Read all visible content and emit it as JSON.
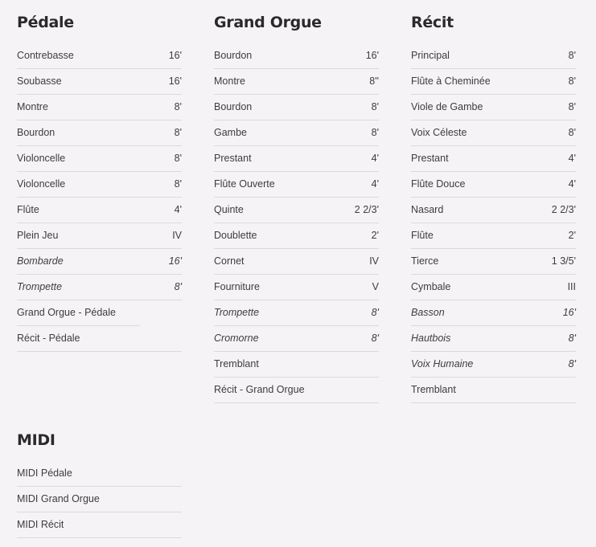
{
  "sections": {
    "pedale": {
      "title": "Pédale",
      "stops": [
        {
          "name": "Contrebasse",
          "size": "16'"
        },
        {
          "name": "Soubasse",
          "size": "16'"
        },
        {
          "name": "Montre",
          "size": "8'"
        },
        {
          "name": "Bourdon",
          "size": "8'"
        },
        {
          "name": "Violoncelle",
          "size": "8'"
        },
        {
          "name": "Violoncelle",
          "size": "8'"
        },
        {
          "name": "Flûte",
          "size": "4'"
        },
        {
          "name": "Plein Jeu",
          "size": "IV"
        },
        {
          "name": "Bombarde",
          "size": "16'"
        },
        {
          "name": "Trompette",
          "size": "8'"
        },
        {
          "name": "Grand Orgue - Pédale",
          "size": ""
        },
        {
          "name": "Récit - Pédale",
          "size": ""
        }
      ]
    },
    "grand_orgue": {
      "title": "Grand Orgue",
      "stops": [
        {
          "name": "Bourdon",
          "size": "16'"
        },
        {
          "name": "Montre",
          "size": "8''"
        },
        {
          "name": "Bourdon",
          "size": "8'"
        },
        {
          "name": "Gambe",
          "size": "8'"
        },
        {
          "name": "Prestant",
          "size": "4'"
        },
        {
          "name": "Flûte Ouverte",
          "size": "4'"
        },
        {
          "name": "Quinte",
          "size": "2 2/3'"
        },
        {
          "name": "Doublette",
          "size": "2'"
        },
        {
          "name": "Cornet",
          "size": "IV"
        },
        {
          "name": "Fourniture",
          "size": "V"
        },
        {
          "name": "Trompette",
          "size": "8'"
        },
        {
          "name": "Cromorne",
          "size": "8'"
        },
        {
          "name": "Tremblant",
          "size": ""
        },
        {
          "name": "Récit - Grand Orgue",
          "size": ""
        }
      ]
    },
    "recit": {
      "title": "Récit",
      "stops": [
        {
          "name": "Principal",
          "size": "8'"
        },
        {
          "name": "Flûte à Cheminée",
          "size": "8'"
        },
        {
          "name": "Viole de Gambe",
          "size": "8'"
        },
        {
          "name": "Voix Céleste",
          "size": "8'"
        },
        {
          "name": "Prestant",
          "size": "4'"
        },
        {
          "name": "Flûte Douce",
          "size": "4'"
        },
        {
          "name": "Nasard",
          "size": "2 2/3'"
        },
        {
          "name": "Flûte",
          "size": "2'"
        },
        {
          "name": "Tierce",
          "size": "1 3/5'"
        },
        {
          "name": "Cymbale",
          "size": "III"
        },
        {
          "name": "Basson",
          "size": "16'"
        },
        {
          "name": "Hautbois",
          "size": "8'"
        },
        {
          "name": "Voix Humaine",
          "size": "8'"
        },
        {
          "name": "Tremblant",
          "size": ""
        }
      ]
    },
    "midi": {
      "title": "MIDI",
      "stops": [
        {
          "name": "MIDI Pédale",
          "size": ""
        },
        {
          "name": "MIDI Grand Orgue",
          "size": ""
        },
        {
          "name": "MIDI Récit",
          "size": ""
        }
      ]
    }
  }
}
